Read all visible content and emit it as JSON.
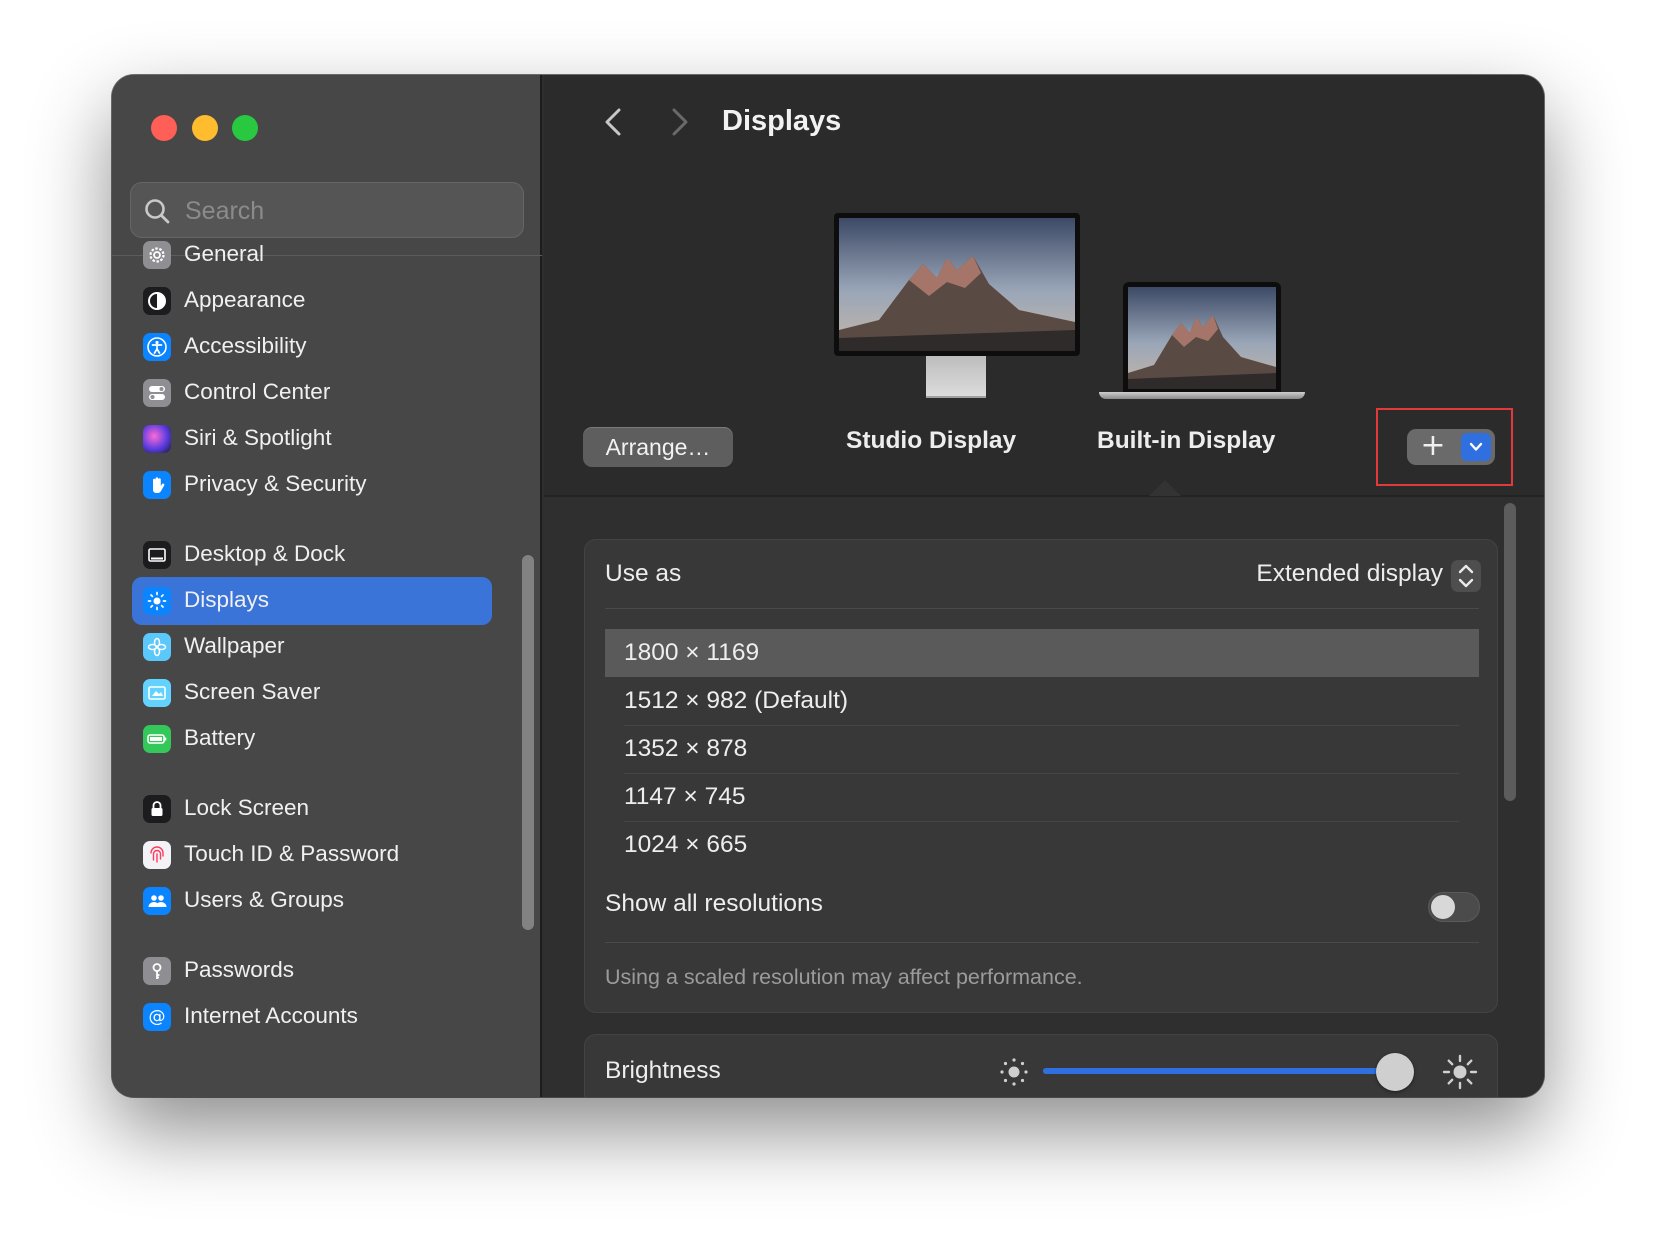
{
  "window": {
    "title": "Displays"
  },
  "search": {
    "placeholder": "Search",
    "icon": "magnifying-glass"
  },
  "sidebar": {
    "items": [
      {
        "label": "General",
        "icon": "gear",
        "color": "#8e8e93"
      },
      {
        "label": "Appearance",
        "icon": "appearance-circle",
        "color": "#1c1c1e"
      },
      {
        "label": "Accessibility",
        "icon": "accessibility-figure",
        "color": "#0a84ff"
      },
      {
        "label": "Control Center",
        "icon": "toggles",
        "color": "#8e8e93"
      },
      {
        "label": "Siri & Spotlight",
        "icon": "siri-orb",
        "color": "#6b3fa0"
      },
      {
        "label": "Privacy & Security",
        "icon": "hand",
        "color": "#0a84ff"
      },
      {
        "label": "Desktop & Dock",
        "icon": "dock",
        "color": "#1c1c1e"
      },
      {
        "label": "Displays",
        "icon": "sun",
        "color": "#0a84ff",
        "selected": true
      },
      {
        "label": "Wallpaper",
        "icon": "flower",
        "color": "#5ac8fa"
      },
      {
        "label": "Screen Saver",
        "icon": "screen-saver",
        "color": "#64d2ff"
      },
      {
        "label": "Battery",
        "icon": "battery",
        "color": "#34c759"
      },
      {
        "label": "Lock Screen",
        "icon": "lock",
        "color": "#1c1c1e"
      },
      {
        "label": "Touch ID & Password",
        "icon": "fingerprint",
        "color": "#f2f2f7"
      },
      {
        "label": "Users & Groups",
        "icon": "users",
        "color": "#0a84ff"
      },
      {
        "label": "Passwords",
        "icon": "key",
        "color": "#8e8e93"
      },
      {
        "label": "Internet Accounts",
        "icon": "at-sign",
        "color": "#0a84ff"
      }
    ]
  },
  "toolbar": {
    "back_icon": "chevron-left",
    "forward_icon": "chevron-right",
    "title": "Displays"
  },
  "displays": {
    "arrange_label": "Arrange…",
    "studio_label": "Studio Display",
    "builtin_label": "Built-in Display",
    "selected": "Built-in Display",
    "add_icon": "plus",
    "add_menu_icon": "chevron-down",
    "highlight_color": "#e03a3a"
  },
  "settings": {
    "use_as_label": "Use as",
    "use_as_value": "Extended display",
    "resolutions": [
      {
        "label": "1800 × 1169",
        "selected": true
      },
      {
        "label": "1512 × 982 (Default)",
        "selected": false
      },
      {
        "label": "1352 × 878",
        "selected": false
      },
      {
        "label": "1147 × 745",
        "selected": false
      },
      {
        "label": "1024 × 665",
        "selected": false
      }
    ],
    "show_all_label": "Show all resolutions",
    "show_all_enabled": false,
    "note": "Using a scaled resolution may affect performance.",
    "brightness_label": "Brightness",
    "brightness_level": 0.95
  },
  "colors": {
    "accent": "#2f6fe0",
    "sidebar_selected": "#3b74d9"
  }
}
